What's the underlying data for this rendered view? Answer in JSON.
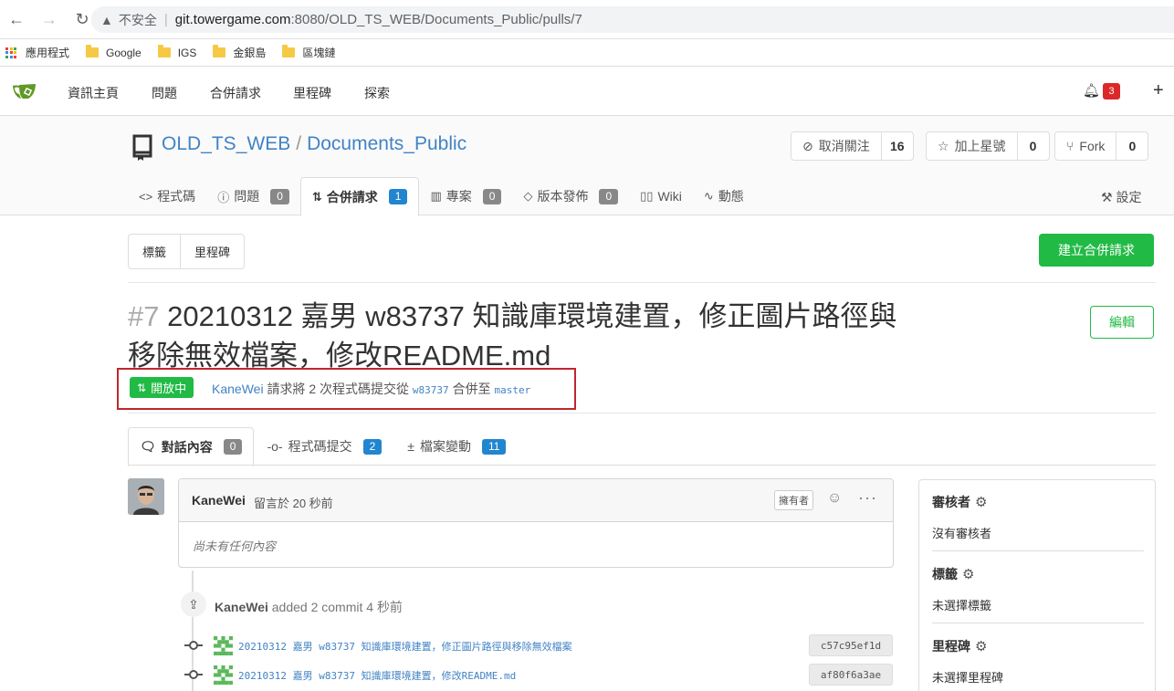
{
  "browser": {
    "insecure_label": "不安全",
    "url_host": "git.towergame.com",
    "url_rest": ":8080/OLD_TS_WEB/Documents_Public/pulls/7",
    "bookmarks": [
      "應用程式",
      "Google",
      "IGS",
      "金銀島",
      "區塊鏈"
    ]
  },
  "nav": {
    "items": [
      "資訊主頁",
      "問題",
      "合併請求",
      "里程碑",
      "探索"
    ],
    "notification_count": "3"
  },
  "repo": {
    "owner": "OLD_TS_WEB",
    "name": "Documents_Public",
    "watch_label": "取消關注",
    "watch_count": "16",
    "star_label": "加上星號",
    "star_count": "0",
    "fork_label": "Fork",
    "fork_count": "0",
    "tabs": [
      {
        "label": "程式碼",
        "icon": "code-icon"
      },
      {
        "label": "問題",
        "icon": "issue-icon",
        "count": "0"
      },
      {
        "label": "合併請求",
        "icon": "pull-request-icon",
        "count": "1"
      },
      {
        "label": "專案",
        "icon": "project-icon",
        "count": "0"
      },
      {
        "label": "版本發佈",
        "icon": "tag-icon",
        "count": "0"
      },
      {
        "label": "Wiki",
        "icon": "book-icon"
      },
      {
        "label": "動態",
        "icon": "pulse-icon"
      }
    ],
    "settings_label": "設定"
  },
  "filters": {
    "labels": "標籤",
    "milestones": "里程碑",
    "new_pr": "建立合併請求"
  },
  "pr": {
    "index": "#7",
    "title": "20210312 嘉男 w83737 知識庫環境建置，修正圖片路徑與移除無效檔案，修改README.md",
    "edit_label": "編輯",
    "state": "開放中",
    "author": "KaneWei",
    "meta_mid": "請求將 2 次程式碼提交從",
    "head_branch": "w83737",
    "meta_into": "合併至",
    "base_branch": "master"
  },
  "pr_tabs": [
    {
      "label": "對話內容",
      "count": "0"
    },
    {
      "label": "程式碼提交",
      "count": "2"
    },
    {
      "label": "檔案變動",
      "count": "11"
    }
  ],
  "comment": {
    "author": "KaneWei",
    "time": "留言於 20 秒前",
    "owner_tag": "擁有者",
    "body": "尚未有任何內容"
  },
  "timeline": {
    "push_user": "KaneWei",
    "push_text": "added 2 commit 4 秒前",
    "commits": [
      {
        "message": "20210312 嘉男 w83737 知識庫環境建置，修正圖片路徑與移除無效檔案",
        "sha": "c57c95ef1d"
      },
      {
        "message": "20210312 嘉男 w83737 知識庫環境建置，修改README.md",
        "sha": "af80f6a3ae"
      }
    ]
  },
  "sidebar": {
    "reviewers_title": "審核者",
    "reviewers_value": "沒有審核者",
    "labels_title": "標籤",
    "labels_value": "未選擇標籤",
    "milestone_title": "里程碑",
    "milestone_value": "未選擇里程碑"
  },
  "colors": {
    "accent_green": "#21ba45",
    "link_blue": "#4183c4",
    "badge_blue": "#2185d0",
    "notification_red": "#db2828",
    "highlight_box_red": "#c0262d"
  }
}
